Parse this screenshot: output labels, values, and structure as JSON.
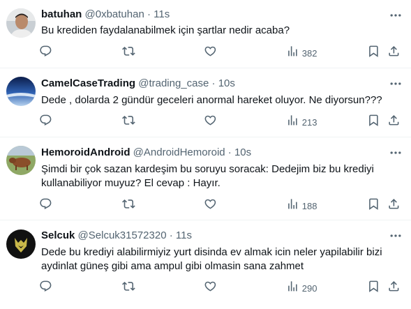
{
  "tweets": [
    {
      "name": "batuhan",
      "handle": "@0xbatuhan",
      "separator": "·",
      "time": "11s",
      "text": [
        "Bu krediden faydalanabilmek için şartlar nedir acaba?"
      ],
      "views": "382"
    },
    {
      "name": "CamelCaseTrading",
      "handle": "@trading_case",
      "separator": "·",
      "time": "10s",
      "text": [
        "Dede , dolarda 2 gündür geceleri anormal hareket oluyor. Ne diyorsun???"
      ],
      "views": "213"
    },
    {
      "name": "HemoroidAndroid",
      "handle": "@AndroidHemoroid",
      "separator": "·",
      "time": "10s",
      "text": [
        "Şimdi bir çok sazan kardeşim bu soruyu soracak: Dedejim biz bu krediyi",
        "kullanabiliyor muyuz? El cevap : Hayır."
      ],
      "views": "188"
    },
    {
      "name": "Selcuk",
      "handle": "@Selcuk31572320",
      "separator": "·",
      "time": "11s",
      "text": [
        "Dede bu krediyi alabilirmiyiz yurt disinda ev almak icin neler yapilabilir bizi",
        "aydinlat güneş gibi ama ampul gibi olmasin sana zahmet"
      ],
      "views": "290"
    }
  ],
  "icons": {
    "more": "more-dots-icon",
    "reply": "reply-icon",
    "retweet": "retweet-icon",
    "like": "like-heart-icon",
    "views": "views-bar-chart-icon",
    "bookmark": "bookmark-icon",
    "share": "share-upload-icon"
  },
  "colors": {
    "text": "#0f1419",
    "secondary": "#536471",
    "divider": "#eff3f4"
  }
}
